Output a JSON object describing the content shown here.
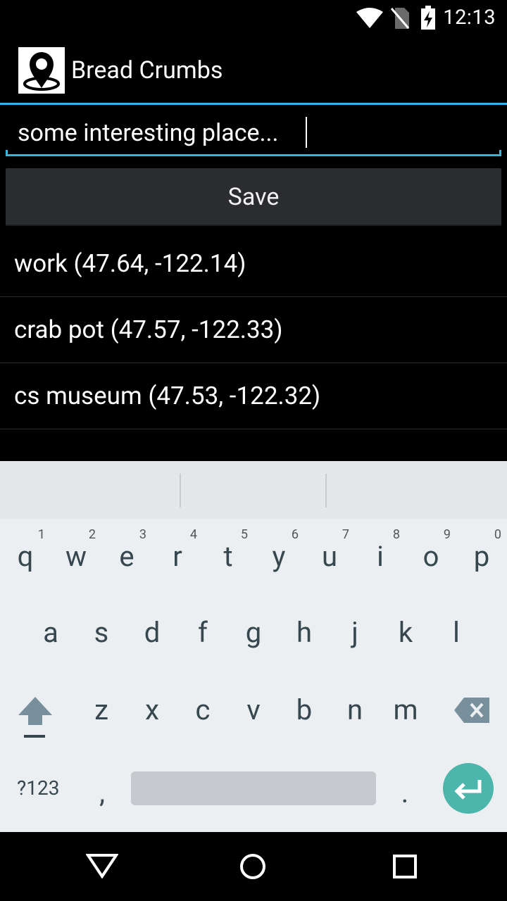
{
  "status_bar": {
    "time": "12:13",
    "icons": [
      "wifi-icon",
      "no-sim-icon",
      "battery-charging-icon"
    ]
  },
  "app": {
    "title": "Bread Crumbs",
    "icon": "map-pin-icon"
  },
  "edit": {
    "value": "some interesting place..."
  },
  "save_button": {
    "label": "Save"
  },
  "crumbs": [
    {
      "label": "work (47.64, -122.14)"
    },
    {
      "label": "crab pot (47.57, -122.33)"
    },
    {
      "label": "cs museum (47.53, -122.32)"
    }
  ],
  "keyboard": {
    "row1": [
      "q",
      "w",
      "e",
      "r",
      "t",
      "y",
      "u",
      "i",
      "o",
      "p"
    ],
    "row1_hints": [
      "1",
      "2",
      "3",
      "4",
      "5",
      "6",
      "7",
      "8",
      "9",
      "0"
    ],
    "row2": [
      "a",
      "s",
      "d",
      "f",
      "g",
      "h",
      "j",
      "k",
      "l"
    ],
    "row3": [
      "z",
      "x",
      "c",
      "v",
      "b",
      "n",
      "m"
    ],
    "symbols_label": "?123",
    "comma": ",",
    "period": ".",
    "accent_color": "#4db6ac"
  },
  "nav": {
    "icons": [
      "back-icon",
      "home-icon",
      "recents-icon"
    ]
  }
}
